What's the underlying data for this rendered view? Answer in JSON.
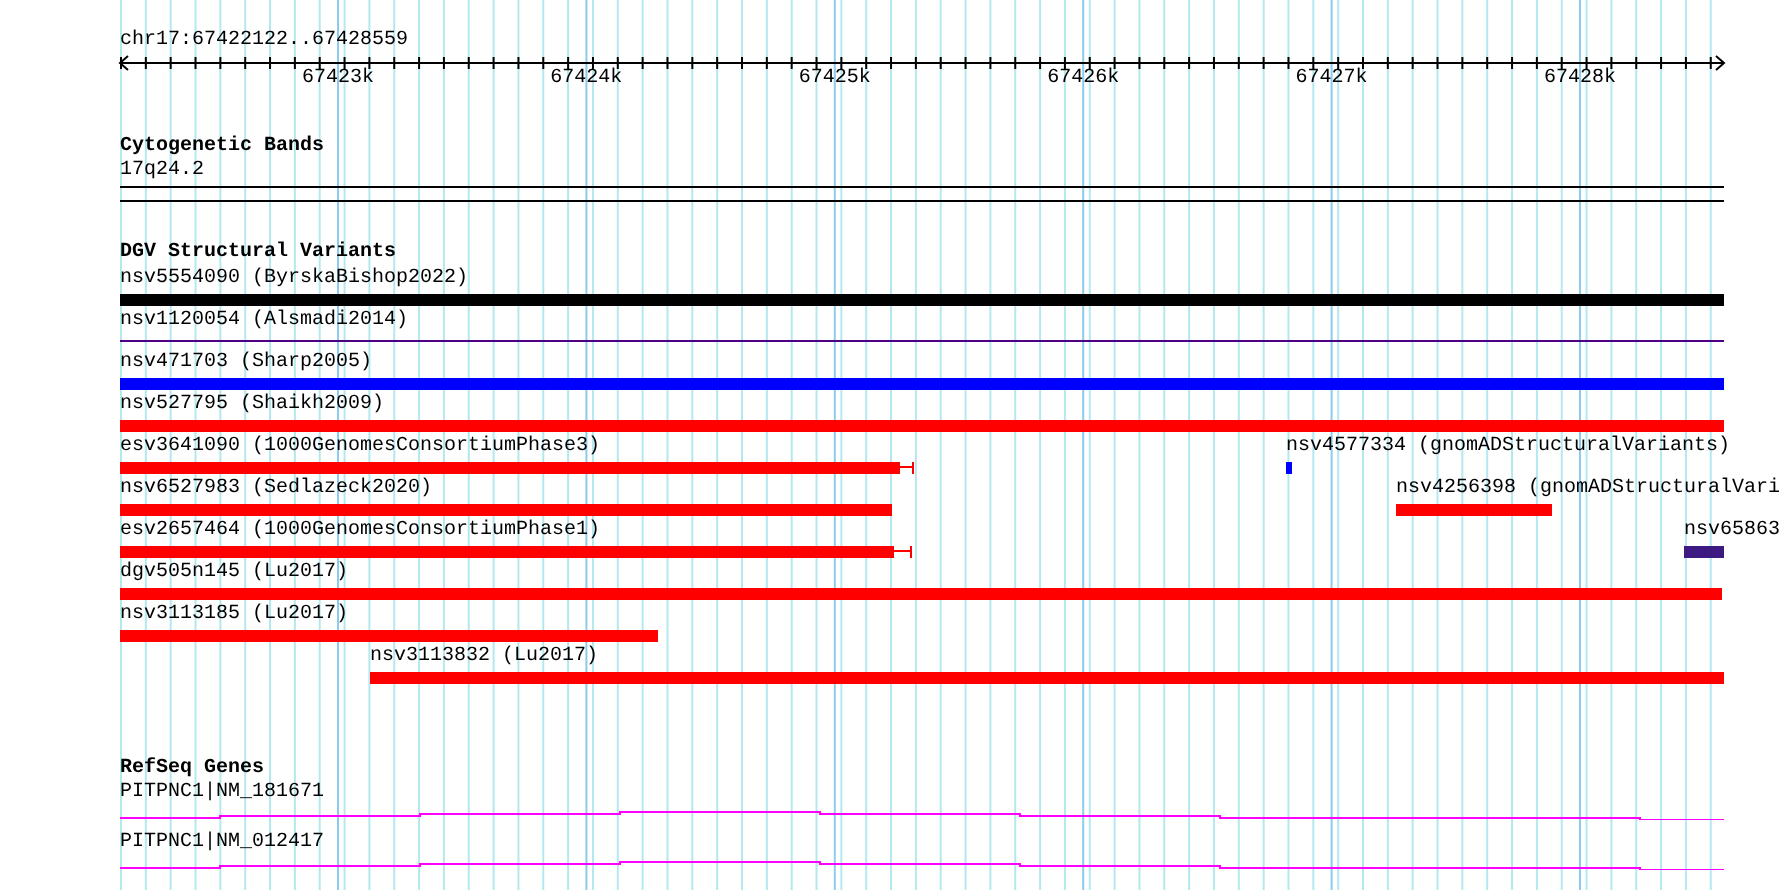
{
  "ruler": {
    "location": "chr17:67422122..67428559",
    "ticks": [
      "67423k",
      "67424k",
      "67425k",
      "67426k",
      "67427k",
      "67428k"
    ]
  },
  "cytoband_track": {
    "title": "Cytogenetic Bands",
    "band": "17q24.2"
  },
  "dgv_track": {
    "title": "DGV Structural Variants",
    "features": [
      {
        "label": "nsv5554090 (ByrskaBishop2022)",
        "color": "#000000",
        "kind": "bar"
      },
      {
        "label": "nsv1120054 (Alsmadi2014)",
        "color": "#4b0082",
        "kind": "line"
      },
      {
        "label": "nsv471703 (Sharp2005)",
        "color": "#0000ff",
        "kind": "bar"
      },
      {
        "label": "nsv527795 (Shaikh2009)",
        "color": "#ff0000",
        "kind": "bar"
      },
      {
        "label": "esv3641090 (1000GenomesConsortiumPhase3)",
        "color": "#ff0000",
        "kind": "whisker"
      },
      {
        "label": "nsv4577334 (gnomADStructuralVariants)",
        "color": "#0000ff",
        "kind": "bar"
      },
      {
        "label": "nsv6527983 (Sedlazeck2020)",
        "color": "#ff0000",
        "kind": "bar"
      },
      {
        "label": "nsv4256398 (gnomADStructuralVari",
        "color": "#ff0000",
        "kind": "bar"
      },
      {
        "label": "esv2657464 (1000GenomesConsortiumPhase1)",
        "color": "#ff0000",
        "kind": "whisker"
      },
      {
        "label": "nsv65863",
        "color": "#3c1a82",
        "kind": "bar"
      },
      {
        "label": "dgv505n145 (Lu2017)",
        "color": "#ff0000",
        "kind": "bar"
      },
      {
        "label": "nsv3113185 (Lu2017)",
        "color": "#ff0000",
        "kind": "bar"
      },
      {
        "label": "nsv3113832 (Lu2017)",
        "color": "#ff0000",
        "kind": "bar"
      }
    ]
  },
  "refseq_track": {
    "title": "RefSeq Genes",
    "genes": [
      {
        "label": "PITPNC1|NM_181671"
      },
      {
        "label": "PITPNC1|NM_012417"
      }
    ]
  }
}
